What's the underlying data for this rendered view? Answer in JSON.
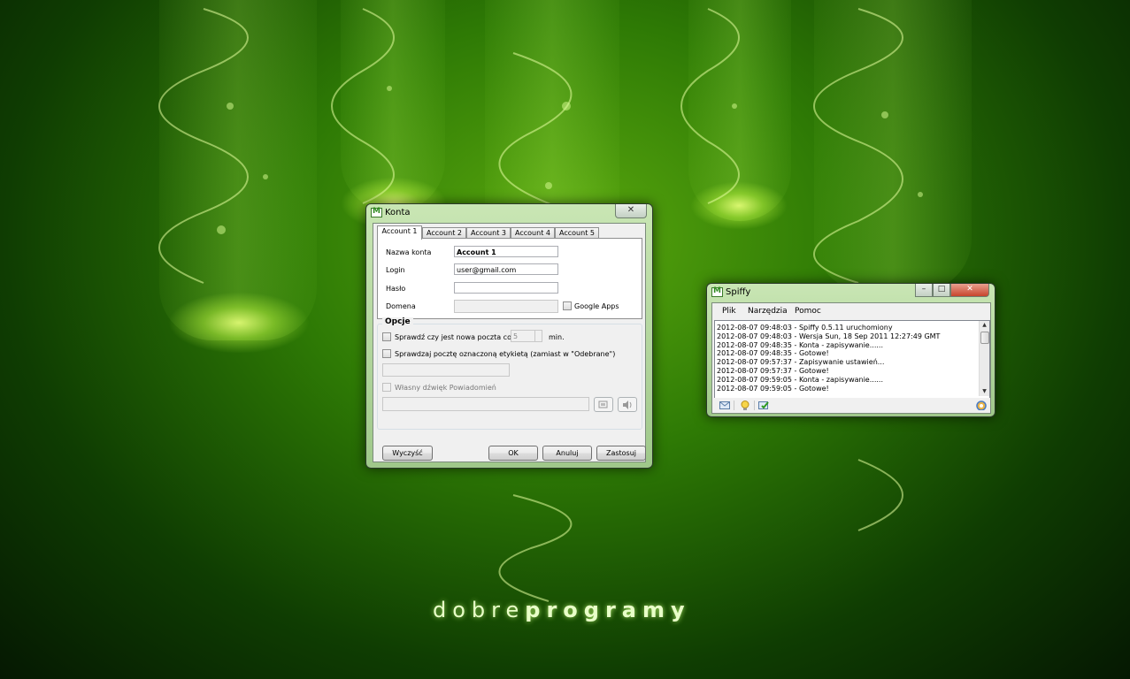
{
  "wallpaper": {
    "brand_light": "dobre",
    "brand_bold": "programy"
  },
  "konta": {
    "title": "Konta",
    "close_glyph": "✕",
    "tabs": [
      "Account 1",
      "Account 2",
      "Account 3",
      "Account 4",
      "Account 5"
    ],
    "active_tab": "Account 1",
    "labels": {
      "nazwa": "Nazwa konta",
      "login": "Login",
      "haslo": "Hasło",
      "domena": "Domena",
      "google_apps": "Google Apps"
    },
    "values": {
      "nazwa": "Account 1",
      "login": "user@gmail.com",
      "haslo": "",
      "domena": ""
    },
    "options": {
      "title": "Opcje",
      "check_new_mail": "Sprawdź czy jest nowa poczta co",
      "interval": "5",
      "interval_unit": "min.",
      "check_label": "Sprawdzaj pocztę oznaczoną etykietą (zamiast w \"Odebrane\")",
      "custom_sound": "Własny dźwięk Powiadomień"
    },
    "buttons": {
      "clear": "Wyczyść",
      "ok": "OK",
      "cancel": "Anuluj",
      "apply": "Zastosuj"
    }
  },
  "spiffy": {
    "title": "Spiffy",
    "menu": [
      "Plik",
      "Narzędzia",
      "Pomoc"
    ],
    "log": [
      "2012-08-07 09:48:03 - Spiffy 0.5.11 uruchomiony",
      "2012-08-07 09:48:03 - Wersja Sun, 18 Sep 2011 12:27:49 GMT",
      "2012-08-07 09:48:35 - Konta - zapisywanie......",
      "2012-08-07 09:48:35 - Gotowe!",
      "2012-08-07 09:57:37 - Zapisywanie ustawień...",
      "2012-08-07 09:57:37 - Gotowe!",
      "2012-08-07 09:59:05 - Konta - zapisywanie......",
      "2012-08-07 09:59:05 - Gotowe!"
    ],
    "toolbar_icons": [
      "mail-icon",
      "lightbulb-icon",
      "check-mail-icon",
      "settings-icon"
    ]
  },
  "colors": {
    "accent_green": "#2f8a20",
    "title_glass": "#b5d8a0"
  }
}
